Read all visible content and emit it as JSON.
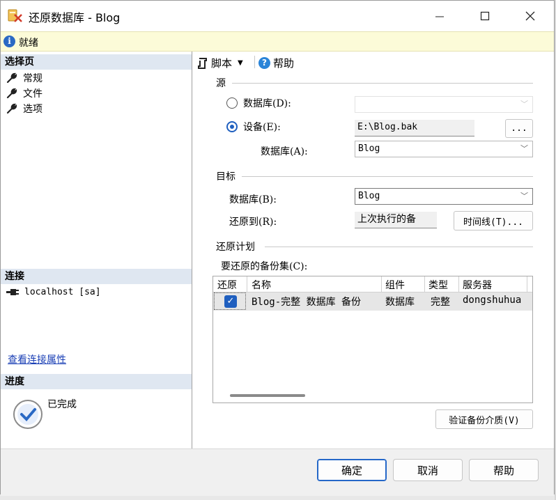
{
  "window": {
    "title": "还原数据库 - Blog"
  },
  "status": {
    "text": "就绪"
  },
  "left": {
    "select_page_header": "选择页",
    "pages": [
      {
        "label": "常规",
        "icon": "wrench-icon"
      },
      {
        "label": "文件",
        "icon": "wrench-icon"
      },
      {
        "label": "选项",
        "icon": "wrench-icon"
      }
    ],
    "connection_header": "连接",
    "connection": "localhost [sa]",
    "view_connection_link": "查看连接属性",
    "progress_header": "进度",
    "progress_status": "已完成"
  },
  "toolbar": {
    "script_label": "脚本",
    "help_label": "帮助"
  },
  "source": {
    "header": "源",
    "database_radio": "数据库(D):",
    "device_radio": "设备(E):",
    "device_value": "E:\\Blog.bak",
    "browse_label": "...",
    "database_label": "数据库(A):",
    "database_value": "Blog"
  },
  "target": {
    "header": "目标",
    "database_label": "数据库(B):",
    "database_value": "Blog",
    "restore_to_label": "还原到(R):",
    "restore_to_value": "上次执行的备",
    "timeline_button": "时间线(T)..."
  },
  "plan": {
    "header": "还原计划",
    "backup_sets_label": "要还原的备份集(C):",
    "columns": [
      "还原",
      "名称",
      "组件",
      "类型",
      "服务器"
    ],
    "rows": [
      {
        "restore": true,
        "name": "Blog-完整 数据库 备份",
        "component": "数据库",
        "type": "完整",
        "server": "dongshuhua"
      }
    ],
    "verify_button": "验证备份介质(V)"
  },
  "footer": {
    "ok": "确定",
    "cancel": "取消",
    "help": "帮助"
  },
  "colors": {
    "accent": "#1f5fbf",
    "status_bg": "#fcfbd8",
    "section_bg": "#dfe7f1",
    "link": "#1a3fb5"
  }
}
